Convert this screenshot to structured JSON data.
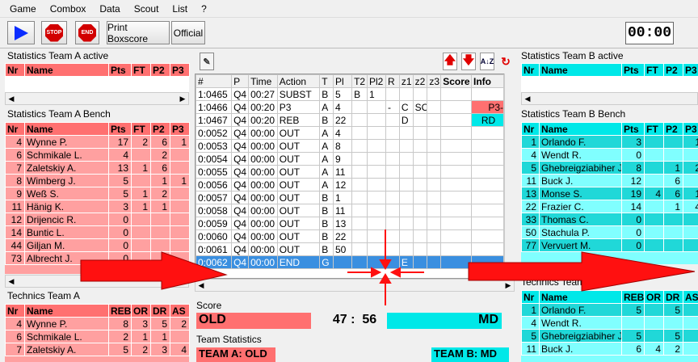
{
  "menu": [
    "Game",
    "Combox",
    "Data",
    "Scout",
    "List",
    "?"
  ],
  "toolbar": {
    "play_icon": "play-icon",
    "stop_label": "STOP",
    "end_label": "END",
    "print_boxscore": "Print Boxscore",
    "official": "Official"
  },
  "clock": "00:00",
  "colors": {
    "team_a_header": "#ff7070",
    "team_a_row": "#ffa0a0",
    "team_b_header": "#00e8e8",
    "team_b_row_dark": "#20d8d8",
    "team_b_row_light": "#80ffff",
    "selected": "#3a8fe0",
    "arrow": "#ff1010"
  },
  "team_a_active": {
    "title": "Statistics Team A active",
    "columns": [
      "Nr",
      "Name",
      "Pts",
      "FT",
      "P2",
      "P3"
    ]
  },
  "team_a_bench": {
    "title": "Statistics Team A Bench",
    "columns": [
      "Nr",
      "Name",
      "Pts",
      "FT",
      "P2",
      "P3"
    ],
    "rows": [
      [
        "4",
        "Wynne P.",
        "17",
        "2",
        "6",
        "1"
      ],
      [
        "6",
        "Schmikale L.",
        "4",
        "",
        "2",
        ""
      ],
      [
        "7",
        "Zaletskiy A.",
        "13",
        "1",
        "6",
        ""
      ],
      [
        "8",
        "Wimberg J.",
        "5",
        "",
        "1",
        "1"
      ],
      [
        "9",
        "Weß S.",
        "5",
        "1",
        "2",
        ""
      ],
      [
        "11",
        "Hänig K.",
        "3",
        "1",
        "1",
        ""
      ],
      [
        "12",
        "Drijencic R.",
        "0",
        "",
        "",
        ""
      ],
      [
        "14",
        "Buntic L.",
        "0",
        "",
        "",
        ""
      ],
      [
        "44",
        "Giljan M.",
        "0",
        "",
        "",
        ""
      ],
      [
        "73",
        "Albrecht J.",
        "0",
        "",
        "",
        ""
      ]
    ]
  },
  "team_a_technics": {
    "title": "Technics Team A",
    "columns": [
      "Nr",
      "Name",
      "REB",
      "OR",
      "DR",
      "AS"
    ],
    "rows": [
      [
        "4",
        "Wynne P.",
        "8",
        "3",
        "5",
        "2"
      ],
      [
        "6",
        "Schmikale L.",
        "2",
        "1",
        "1",
        ""
      ],
      [
        "7",
        "Zaletskiy A.",
        "5",
        "2",
        "3",
        "4"
      ]
    ]
  },
  "team_b_active": {
    "title": "Statistics Team B active",
    "columns": [
      "Nr",
      "Name",
      "Pts",
      "FT",
      "P2",
      "P3"
    ]
  },
  "team_b_bench": {
    "title": "Statistics Team B Bench",
    "columns": [
      "Nr",
      "Name",
      "Pts",
      "FT",
      "P2",
      "P3"
    ],
    "rows": [
      [
        "1",
        "Orlando F.",
        "3",
        "",
        "",
        "1"
      ],
      [
        "4",
        "Wendt R.",
        "0",
        "",
        "",
        ""
      ],
      [
        "5",
        "Ghebreigziabiher J.",
        "8",
        "",
        "1",
        "2"
      ],
      [
        "11",
        "Buck J.",
        "12",
        "",
        "6",
        ""
      ],
      [
        "13",
        "Monse S.",
        "19",
        "4",
        "6",
        "1"
      ],
      [
        "22",
        "Frazier C.",
        "14",
        "",
        "1",
        "4"
      ],
      [
        "33",
        "Thomas C.",
        "0",
        "",
        "",
        ""
      ],
      [
        "50",
        "Stachula P.",
        "0",
        "",
        "",
        ""
      ],
      [
        "77",
        "Vervuert M.",
        "0",
        "",
        "",
        ""
      ]
    ]
  },
  "team_b_technics": {
    "title": "Technics Team B",
    "columns": [
      "Nr",
      "Name",
      "REB",
      "OR",
      "DR",
      "AS"
    ],
    "rows": [
      [
        "1",
        "Orlando F.",
        "5",
        "",
        "5",
        ""
      ],
      [
        "4",
        "Wendt R.",
        "",
        "",
        "",
        ""
      ],
      [
        "5",
        "Ghebreigziabiher J.",
        "5",
        "",
        "5",
        ""
      ],
      [
        "11",
        "Buck J.",
        "6",
        "4",
        "2",
        ""
      ]
    ]
  },
  "pbp": {
    "columns": [
      "#",
      "P",
      "Time",
      "Action",
      "T",
      "Pl",
      "T2",
      "Pl2",
      "R",
      "z1",
      "z2",
      "z3",
      "Score",
      "Info"
    ],
    "rows": [
      [
        "1:0465",
        "Q4",
        "00:27",
        "SUBST",
        "B",
        "5",
        "B",
        "1",
        "",
        "",
        "",
        "",
        "",
        ""
      ],
      [
        "1:0466",
        "Q4",
        "00:20",
        "P3",
        "A",
        "4",
        "",
        "",
        "-",
        "C",
        "SCJS",
        "",
        "",
        "P3-"
      ],
      [
        "1:0467",
        "Q4",
        "00:20",
        "REB",
        "B",
        "22",
        "",
        "",
        "",
        "D",
        "",
        "",
        "",
        "RD"
      ],
      [
        "0:0052",
        "Q4",
        "00:00",
        "OUT",
        "A",
        "4",
        "",
        "",
        "",
        "",
        "",
        "",
        "",
        ""
      ],
      [
        "0:0053",
        "Q4",
        "00:00",
        "OUT",
        "A",
        "8",
        "",
        "",
        "",
        "",
        "",
        "",
        "",
        ""
      ],
      [
        "0:0054",
        "Q4",
        "00:00",
        "OUT",
        "A",
        "9",
        "",
        "",
        "",
        "",
        "",
        "",
        "",
        ""
      ],
      [
        "0:0055",
        "Q4",
        "00:00",
        "OUT",
        "A",
        "11",
        "",
        "",
        "",
        "",
        "",
        "",
        "",
        ""
      ],
      [
        "0:0056",
        "Q4",
        "00:00",
        "OUT",
        "A",
        "12",
        "",
        "",
        "",
        "",
        "",
        "",
        "",
        ""
      ],
      [
        "0:0057",
        "Q4",
        "00:00",
        "OUT",
        "B",
        "1",
        "",
        "",
        "",
        "",
        "",
        "",
        "",
        ""
      ],
      [
        "0:0058",
        "Q4",
        "00:00",
        "OUT",
        "B",
        "11",
        "",
        "",
        "",
        "",
        "",
        "",
        "",
        ""
      ],
      [
        "0:0059",
        "Q4",
        "00:00",
        "OUT",
        "B",
        "13",
        "",
        "",
        "",
        "",
        "",
        "",
        "",
        ""
      ],
      [
        "0:0060",
        "Q4",
        "00:00",
        "OUT",
        "B",
        "22",
        "",
        "",
        "",
        "",
        "",
        "",
        "",
        ""
      ],
      [
        "0:0061",
        "Q4",
        "00:00",
        "OUT",
        "B",
        "50",
        "",
        "",
        "",
        "",
        "",
        "",
        "",
        ""
      ],
      [
        "0:0062",
        "Q4",
        "00:00",
        "END",
        "G",
        "",
        "",
        "",
        "",
        "E",
        "",
        "",
        "",
        ""
      ]
    ]
  },
  "score": {
    "title": "Score",
    "team_a": "OLD",
    "value": "47 :  56",
    "team_b": "MD"
  },
  "team_stats": {
    "title": "Team Statistics",
    "team_a": "TEAM A: OLD",
    "team_b": "TEAM B: MD"
  }
}
